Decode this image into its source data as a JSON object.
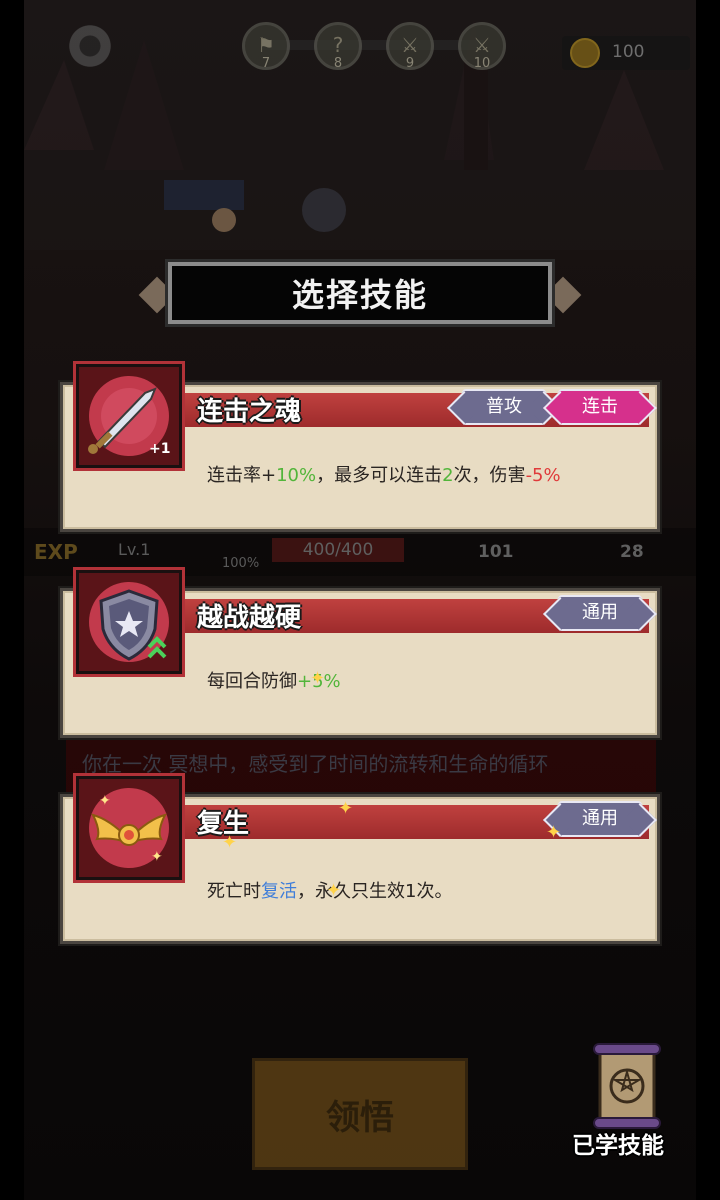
{
  "hud": {
    "stages": [
      {
        "num": "7",
        "icon": "flag-icon"
      },
      {
        "num": "8",
        "icon": "question-icon"
      },
      {
        "num": "9",
        "icon": "crossed-swords-icon"
      },
      {
        "num": "10",
        "icon": "sword-icon"
      }
    ],
    "coins": "100"
  },
  "background_stats": {
    "exp_label": "EXP",
    "level": "Lv.1",
    "hp_percent": "100%",
    "hp_value": "400/400",
    "attack": "101",
    "defense": "28",
    "story_text": "你在一次 冥想中，感受到了时间的流转和生命的循环"
  },
  "dialog": {
    "title": "选择技能",
    "skills": [
      {
        "name": "连击之魂",
        "tags": [
          "普攻",
          "连击"
        ],
        "icon": "sword-icon",
        "icon_badge": "+1",
        "desc": {
          "p1": "连击率+",
          "v1": "10%",
          "p2": "，最多可以连击",
          "v2": "2",
          "p3": "次，伤害",
          "v3": "-5%"
        }
      },
      {
        "name": "越战越硬",
        "tags": [
          "通用"
        ],
        "icon": "shield-star-icon",
        "desc": {
          "p1": "每回合防御",
          "v1": "+5%"
        }
      },
      {
        "name": "复生",
        "tags": [
          "通用"
        ],
        "icon": "winged-rebirth-icon",
        "desc": {
          "p1": "死亡时",
          "v1": "复活",
          "p2": "，永久只生效1次。"
        }
      }
    ]
  },
  "actions": {
    "confirm_label": "领悟",
    "learned_skills_label": "已学技能"
  },
  "colors": {
    "card_bg": "#e8dcc3",
    "name_bar": "#c0413f",
    "tag_common": "#6d6b8f",
    "tag_combo": "#d6308c",
    "positive": "#52b53a",
    "negative": "#e03a3a",
    "highlight": "#3f7ed9"
  }
}
